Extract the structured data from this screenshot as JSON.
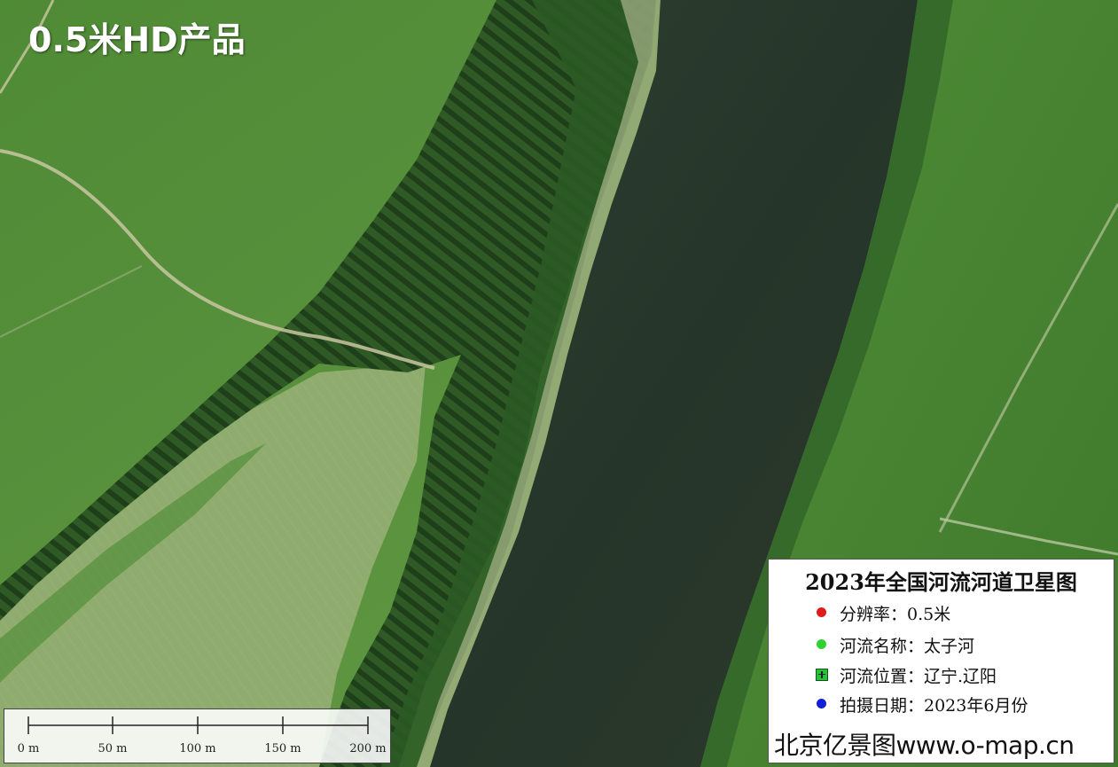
{
  "product_label": "0.5米HD产品",
  "legend": {
    "title": "2023年全国河流河道卫星图",
    "items": [
      {
        "symbol": "red-dot-icon",
        "color": "#e01b1b",
        "text": "分辨率：0.5米"
      },
      {
        "symbol": "green-dot-icon",
        "color": "#2fd12f",
        "text": "河流名称：太子河"
      },
      {
        "symbol": "green-flag-icon",
        "color": "#22c43a",
        "text": "河流位置：辽宁.辽阳"
      },
      {
        "symbol": "blue-dot-icon",
        "color": "#1020d8",
        "text": "拍摄日期：2023年6月份"
      }
    ],
    "footer": "北京亿景图www.o-map.cn"
  },
  "scale_bar": {
    "labels": [
      "0 m",
      "50 m",
      "100 m",
      "150 m",
      "200 m"
    ]
  },
  "colors": {
    "river": "#2a3b2e",
    "field": "#5e8f3e",
    "forest": "#2d5226"
  }
}
